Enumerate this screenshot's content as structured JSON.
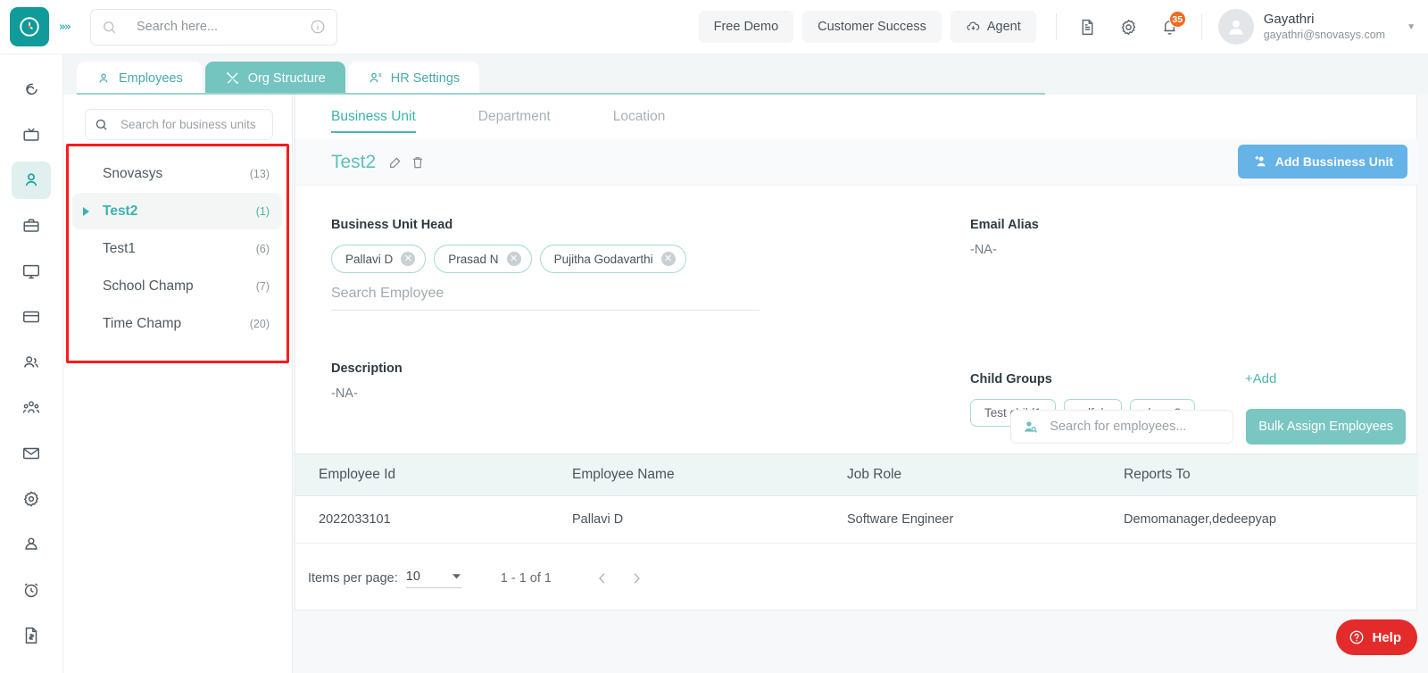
{
  "topbar": {
    "logo_icon": "clock-logo-icon",
    "expander_icon": "chevrons-right-icon",
    "search_placeholder": "Search here...",
    "search_value": "",
    "search_icon": "search-icon",
    "info_icon": "info-circle-icon",
    "pills": [
      {
        "label": "Free Demo",
        "icon": null
      },
      {
        "label": "Customer Success",
        "icon": null
      },
      {
        "label": "Agent",
        "icon": "cloud-download-icon"
      }
    ],
    "icons": [
      {
        "name": "document-icon"
      },
      {
        "name": "gear-icon"
      },
      {
        "name": "bell-icon",
        "badge": "35"
      }
    ],
    "user": {
      "name": "Gayathri",
      "email": "gayathri@snovasys.com",
      "avatar_icon": "user-avatar-icon",
      "caret_icon": "chevron-down-icon"
    }
  },
  "rail": {
    "items": [
      {
        "name": "spiral-icon",
        "active": false
      },
      {
        "name": "tv-icon",
        "active": false
      },
      {
        "name": "person-icon",
        "active": true
      },
      {
        "name": "briefcase-icon",
        "active": false
      },
      {
        "name": "monitor-icon",
        "active": false
      },
      {
        "name": "card-icon",
        "active": false
      },
      {
        "name": "two-users-icon",
        "active": false
      },
      {
        "name": "group-people-icon",
        "active": false
      },
      {
        "name": "mail-icon",
        "active": false
      },
      {
        "name": "settings-gear-icon",
        "active": false
      },
      {
        "name": "user-circle-icon",
        "active": false
      },
      {
        "name": "alarm-clock-icon",
        "active": false
      },
      {
        "name": "invoice-icon",
        "active": false
      }
    ]
  },
  "tabs": [
    {
      "label": "Employees",
      "icon": "person-outline-icon",
      "active": false
    },
    {
      "label": "Org Structure",
      "icon": "tools-icon",
      "active": true
    },
    {
      "label": "HR Settings",
      "icon": "hr-person-icon",
      "active": false
    }
  ],
  "left_panel": {
    "search_placeholder": "Search for business units",
    "search_value": "",
    "search_icon": "search-icon",
    "highlight_color": "#fc1b1b",
    "items": [
      {
        "label": "Snovasys",
        "count": "(13)",
        "selected": false
      },
      {
        "label": "Test2",
        "count": "(1)",
        "selected": true
      },
      {
        "label": "Test1",
        "count": "(6)",
        "selected": false
      },
      {
        "label": "School Champ",
        "count": "(7)",
        "selected": false
      },
      {
        "label": "Time Champ",
        "count": "(20)",
        "selected": false
      }
    ]
  },
  "main": {
    "subtabs": [
      {
        "label": "Business Unit",
        "active": true
      },
      {
        "label": "Department",
        "active": false
      },
      {
        "label": "Location",
        "active": false
      }
    ],
    "title": "Test2",
    "edit_icon": "edit-pencil-icon",
    "delete_icon": "trash-icon",
    "add_button": {
      "label": "Add Bussiness Unit",
      "icon": "add-user-icon",
      "color": "#66b3e8"
    },
    "business_unit_head": {
      "label": "Business Unit Head",
      "chips": [
        "Pallavi D",
        "Prasad N",
        "Pujitha Godavarthi"
      ],
      "search_placeholder": "Search Employee",
      "search_value": ""
    },
    "description": {
      "label": "Description",
      "value": "-NA-"
    },
    "email_alias": {
      "label": "Email Alias",
      "value": "-NA-"
    },
    "child_groups": {
      "label": "Child Groups",
      "add_label": "+Add",
      "chips": [
        "Test child1",
        "sdfgh",
        "demo2"
      ]
    },
    "employee_search": {
      "placeholder": "Search for employees...",
      "value": "",
      "icon": "user-search-icon"
    },
    "bulk_assign_label": "Bulk Assign Employees",
    "table": {
      "columns": [
        "Employee Id",
        "Employee Name",
        "Job Role",
        "Reports To"
      ],
      "rows": [
        [
          "2022033101",
          "Pallavi D",
          "Software Engineer",
          "Demomanager,dedeepyap"
        ]
      ]
    },
    "pagination": {
      "items_per_page_label": "Items per page:",
      "items_per_page_value": "10",
      "dropdown_icon": "caret-down-icon",
      "range": "1 - 1 of 1",
      "prev_icon": "chevron-left-icon",
      "next_icon": "chevron-right-icon"
    }
  },
  "help": {
    "label": "Help",
    "icon": "question-circle-icon",
    "color": "#e32b2b"
  }
}
